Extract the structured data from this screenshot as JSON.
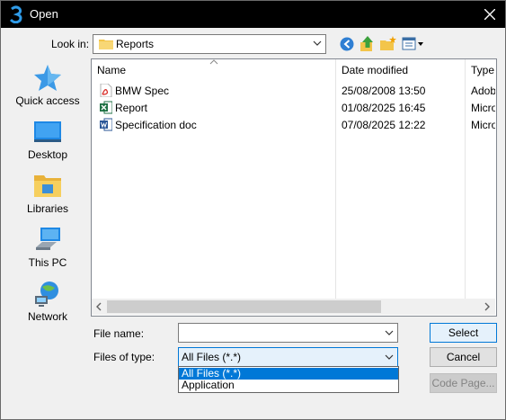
{
  "window": {
    "title": "Open"
  },
  "lookin": {
    "label": "Look in:",
    "value": "Reports"
  },
  "toolbar": {
    "back_icon": "back-arrow-icon",
    "up_icon": "up-folder-icon",
    "new_folder_icon": "new-folder-icon",
    "view_icon": "view-menu-icon"
  },
  "places": [
    {
      "label": "Quick access",
      "icon": "quick-access-star-icon"
    },
    {
      "label": "Desktop",
      "icon": "desktop-icon"
    },
    {
      "label": "Libraries",
      "icon": "libraries-icon"
    },
    {
      "label": "This PC",
      "icon": "computer-icon"
    },
    {
      "label": "Network",
      "icon": "network-icon"
    }
  ],
  "filelist": {
    "columns": [
      "Name",
      "Date modified",
      "Type"
    ],
    "rows": [
      {
        "name": "BMW Spec",
        "date": "25/08/2008 13:50",
        "type": "Adob",
        "icon": "pdf-file-icon"
      },
      {
        "name": "Report",
        "date": "01/08/2025 16:45",
        "type": "Micro",
        "icon": "excel-file-icon"
      },
      {
        "name": "Specification doc",
        "date": "07/08/2025 12:22",
        "type": "Micro",
        "icon": "word-file-icon"
      }
    ]
  },
  "filename": {
    "label": "File name:",
    "value": ""
  },
  "filetype": {
    "label": "Files of type:",
    "value": "All Files (*.*)",
    "options": [
      "All Files (*.*)",
      "Application"
    ]
  },
  "buttons": {
    "select": "Select",
    "cancel": "Cancel",
    "codepage": "Code Page..."
  },
  "colors": {
    "accent": "#0078d7",
    "titlebar": "#000000",
    "dialog_bg": "#f0f0f0"
  }
}
